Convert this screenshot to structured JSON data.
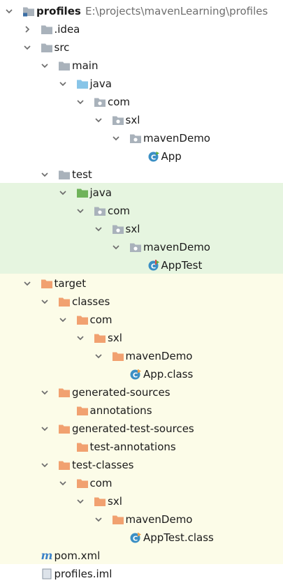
{
  "project": {
    "name": "profiles",
    "path": "E:\\projects\\mavenLearning\\profiles"
  },
  "nodes": [
    {
      "label": "profiles",
      "level": 0,
      "state": "open",
      "icon": "module-folder",
      "bold": true
    },
    {
      "label": ".idea",
      "level": 1,
      "state": "closed",
      "icon": "folder-gray"
    },
    {
      "label": "src",
      "level": 1,
      "state": "open",
      "icon": "folder-gray"
    },
    {
      "label": "main",
      "level": 2,
      "state": "open",
      "icon": "folder-gray"
    },
    {
      "label": "java",
      "level": 3,
      "state": "open",
      "icon": "source-root-folder"
    },
    {
      "label": "com",
      "level": 4,
      "state": "open",
      "icon": "package-folder"
    },
    {
      "label": "sxl",
      "level": 5,
      "state": "open",
      "icon": "package-folder"
    },
    {
      "label": "mavenDemo",
      "level": 6,
      "state": "open",
      "icon": "package-folder"
    },
    {
      "label": "App",
      "level": 7,
      "state": "leaf",
      "icon": "java-class"
    },
    {
      "label": "test",
      "level": 2,
      "state": "open",
      "icon": "folder-gray"
    },
    {
      "label": "java",
      "level": 3,
      "state": "open",
      "icon": "test-root-folder"
    },
    {
      "label": "com",
      "level": 4,
      "state": "open",
      "icon": "package-folder"
    },
    {
      "label": "sxl",
      "level": 5,
      "state": "open",
      "icon": "package-folder"
    },
    {
      "label": "mavenDemo",
      "level": 6,
      "state": "open",
      "icon": "package-folder"
    },
    {
      "label": "AppTest",
      "level": 7,
      "state": "leaf",
      "icon": "java-test-class"
    },
    {
      "label": "target",
      "level": 1,
      "state": "open",
      "icon": "excluded-folder"
    },
    {
      "label": "classes",
      "level": 2,
      "state": "open",
      "icon": "excluded-folder"
    },
    {
      "label": "com",
      "level": 3,
      "state": "open",
      "icon": "excluded-folder"
    },
    {
      "label": "sxl",
      "level": 4,
      "state": "open",
      "icon": "excluded-folder"
    },
    {
      "label": "mavenDemo",
      "level": 5,
      "state": "open",
      "icon": "excluded-folder"
    },
    {
      "label": "App.class",
      "level": 6,
      "state": "leaf",
      "icon": "compiled-class"
    },
    {
      "label": "generated-sources",
      "level": 2,
      "state": "open",
      "icon": "excluded-folder"
    },
    {
      "label": "annotations",
      "level": 3,
      "state": "leaf",
      "icon": "excluded-folder"
    },
    {
      "label": "generated-test-sources",
      "level": 2,
      "state": "open",
      "icon": "excluded-folder"
    },
    {
      "label": "test-annotations",
      "level": 3,
      "state": "leaf",
      "icon": "excluded-folder"
    },
    {
      "label": "test-classes",
      "level": 2,
      "state": "open",
      "icon": "excluded-folder"
    },
    {
      "label": "com",
      "level": 3,
      "state": "open",
      "icon": "excluded-folder"
    },
    {
      "label": "sxl",
      "level": 4,
      "state": "open",
      "icon": "excluded-folder"
    },
    {
      "label": "mavenDemo",
      "level": 5,
      "state": "open",
      "icon": "excluded-folder"
    },
    {
      "label": "AppTest.class",
      "level": 6,
      "state": "leaf",
      "icon": "compiled-class"
    },
    {
      "label": "pom.xml",
      "level": 1,
      "state": "leaf",
      "icon": "maven-file"
    },
    {
      "label": "profiles.iml",
      "level": 1,
      "state": "leaf",
      "icon": "iml-file"
    }
  ],
  "colors": {
    "folder_gray": "#a9b2bb",
    "source_root": "#88c5e8",
    "test_root": "#6fb35a",
    "excluded": "#f1a170",
    "test_band": "#e6f5e0",
    "excluded_band": "#fcfce8",
    "class_blue": "#3b8fc4",
    "maven_blue": "#3c82c8"
  }
}
